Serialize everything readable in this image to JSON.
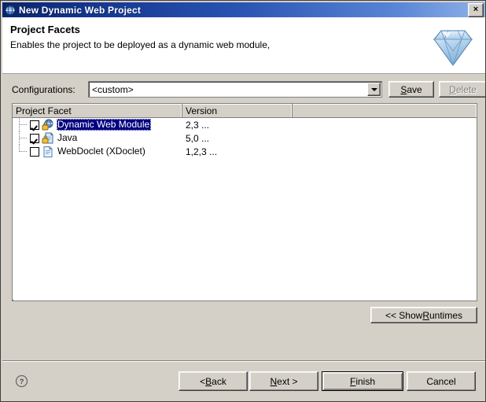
{
  "window": {
    "title": "New Dynamic Web Project",
    "icon": "eclipse-globe-icon",
    "close_label": "×"
  },
  "header": {
    "title": "Project Facets",
    "description": "Enables the project to be deployed as a dynamic web module,",
    "banner_icon": "diamond-gem-icon"
  },
  "configurations": {
    "label": "Configurations:",
    "selected_value": "<custom>",
    "save_label_pre": "",
    "save_mnemonic": "S",
    "save_label_post": "ave",
    "delete_label_pre": "",
    "delete_mnemonic": "D",
    "delete_label_post": "elete",
    "delete_enabled": false
  },
  "facets_table": {
    "columns": [
      "Project Facet",
      "Version",
      ""
    ],
    "rows": [
      {
        "name": "Dynamic Web Module",
        "version": "2,3 ...",
        "checked": true,
        "selected": true,
        "icon": "web-module-locked-icon"
      },
      {
        "name": "Java",
        "version": "5,0 ...",
        "checked": true,
        "selected": false,
        "icon": "java-locked-icon"
      },
      {
        "name": "WebDoclet (XDoclet)",
        "version": "1,2,3 ...",
        "checked": false,
        "selected": false,
        "icon": "document-icon"
      }
    ]
  },
  "runtimes_button": {
    "label_pre": "<< Show ",
    "mnemonic": "R",
    "label_post": "untimes"
  },
  "footer": {
    "help_label": "?",
    "back_pre": "< ",
    "back_mnemonic": "B",
    "back_post": "ack",
    "next_pre": "",
    "next_mnemonic": "N",
    "next_post": "ext >",
    "finish_pre": "",
    "finish_mnemonic": "F",
    "finish_post": "inish",
    "cancel_label": "Cancel"
  },
  "colors": {
    "titlebar_start": "#0a246a",
    "titlebar_end": "#8fb3e8",
    "dialog_face": "#d4d0c8",
    "selection": "#000080",
    "disabled_text": "#808080"
  }
}
